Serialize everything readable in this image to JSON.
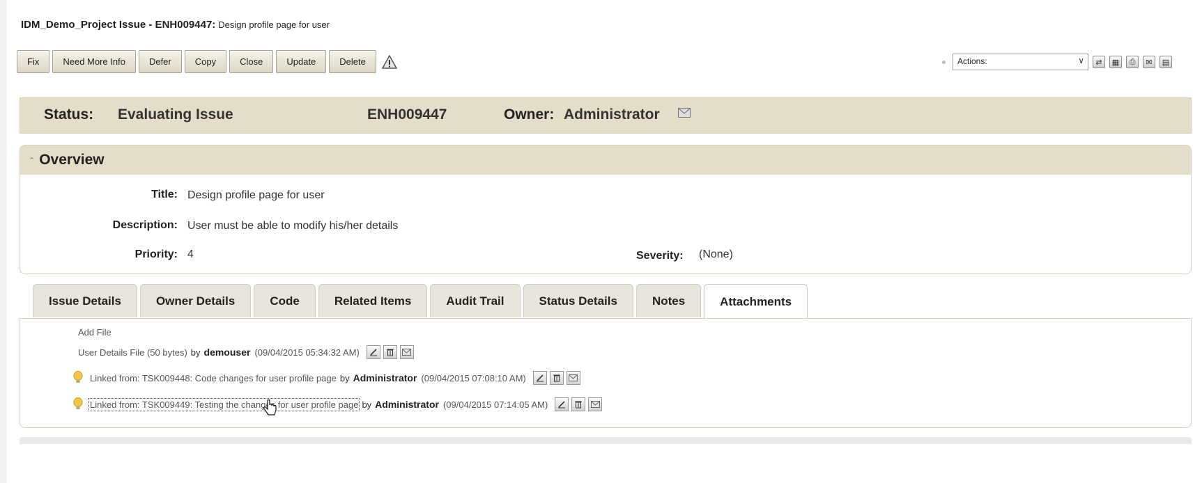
{
  "header": {
    "title": "IDM_Demo_Project Issue - ENH009447:",
    "subtitle": "Design profile page for user"
  },
  "toolbar": {
    "buttons": [
      "Fix",
      "Need More Info",
      "Defer",
      "Copy",
      "Close",
      "Update",
      "Delete"
    ],
    "actions_select": "Actions:"
  },
  "status_bar": {
    "status_label": "Status:",
    "status_value": "Evaluating Issue",
    "issue_id": "ENH009447",
    "owner_label": "Owner:",
    "owner_value": "Administrator"
  },
  "overview": {
    "heading": "Overview",
    "title_label": "Title:",
    "title_value": "Design profile page for user",
    "description_label": "Description:",
    "description_value": "User must be able to modify his/her details",
    "priority_label": "Priority:",
    "priority_value": "4",
    "severity_label": "Severity:",
    "severity_value": "(None)"
  },
  "tabs": [
    "Issue Details",
    "Owner Details",
    "Code",
    "Related Items",
    "Audit Trail",
    "Status Details",
    "Notes",
    "Attachments"
  ],
  "active_tab": "Attachments",
  "attachments": {
    "add_file": "Add File",
    "items": [
      {
        "link": "User Details File (50 bytes)",
        "by": "by",
        "user": "demouser",
        "date": "(09/04/2015 05:34:32 AM)"
      },
      {
        "link": "Linked from: TSK009448: Code changes for user profile page",
        "by": "by",
        "user": "Administrator",
        "date": "(09/04/2015 07:08:10 AM)"
      },
      {
        "link": "Linked from: TSK009449: Testing the changes for user profile page",
        "by": "by",
        "user": "Administrator",
        "date": "(09/04/2015 07:14:05 AM)"
      }
    ]
  },
  "colors": {
    "header_band": "#e4ddc9",
    "button_fill": "#ddd6c4",
    "bulb": "#f2c744"
  }
}
